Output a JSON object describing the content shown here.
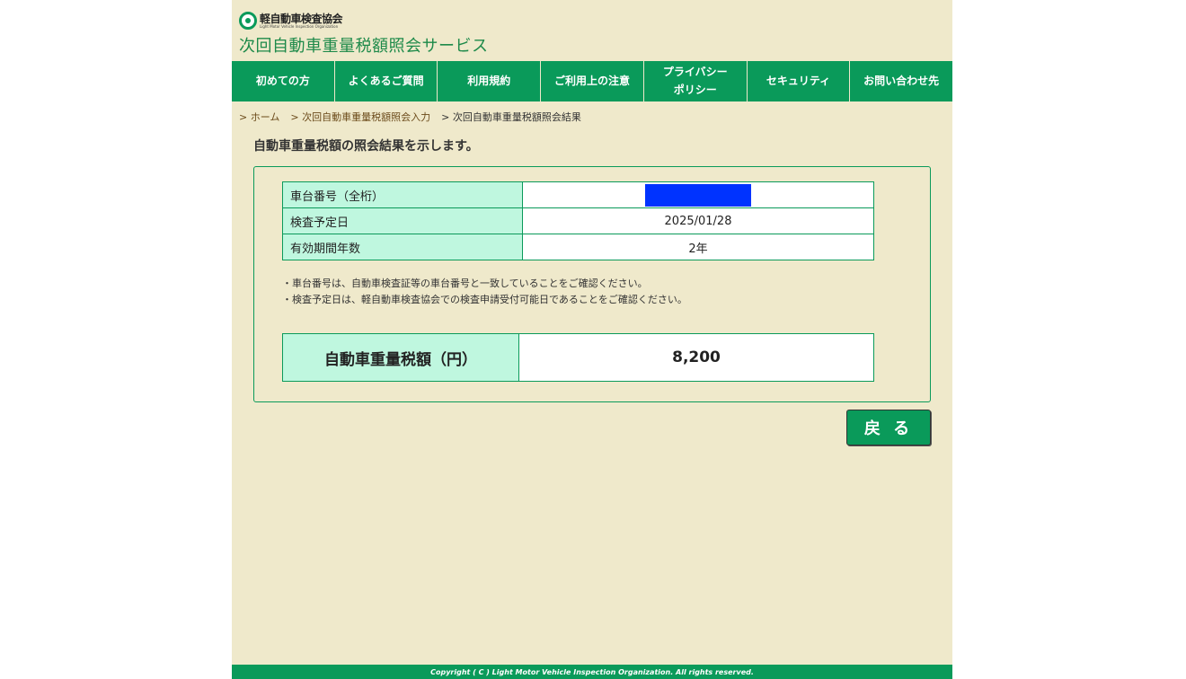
{
  "header": {
    "logo_jp": "軽自動車検査協会",
    "logo_en": "Light Motor Vehicle Inspection Organization",
    "site_title": "次回自動車重量税額照会サービス"
  },
  "nav": [
    {
      "label": "初めての方"
    },
    {
      "label": "よくあるご質問"
    },
    {
      "label": "利用規約"
    },
    {
      "label": "ご利用上の注意"
    },
    {
      "label": "プライバシー\nポリシー"
    },
    {
      "label": "セキュリティ"
    },
    {
      "label": "お問い合わせ先"
    }
  ],
  "breadcrumb": {
    "items": [
      {
        "label": "> ホーム"
      },
      {
        "label": "> 次回自動車重量税額照会入力"
      },
      {
        "label": "> 次回自動車重量税額照会結果"
      }
    ]
  },
  "main": {
    "lead": "自動車重量税額の照会結果を示します。",
    "info_rows": [
      {
        "key": "車台番号（全桁）",
        "value": ""
      },
      {
        "key": "検査予定日",
        "value": "2025/01/28"
      },
      {
        "key": "有効期間年数",
        "value": "2年"
      }
    ],
    "notes": [
      "・車台番号は、自動車検査証等の車台番号と一致していることをご確認ください。",
      "・検査予定日は、軽自動車検査協会での検査申請受付可能日であることをご確認ください。"
    ],
    "tax": {
      "key": "自動車重量税額（円）",
      "value": "8,200"
    },
    "back_label": "戻 る"
  },
  "footer": {
    "copyright": "Copyright ( C ) Light Motor Vehicle Inspection Organization. All rights reserved."
  },
  "colors": {
    "brand_green": "#0a9a5a",
    "page_bg": "#efe9cb",
    "key_cell": "#bff7df",
    "redaction": "#0033ff"
  }
}
